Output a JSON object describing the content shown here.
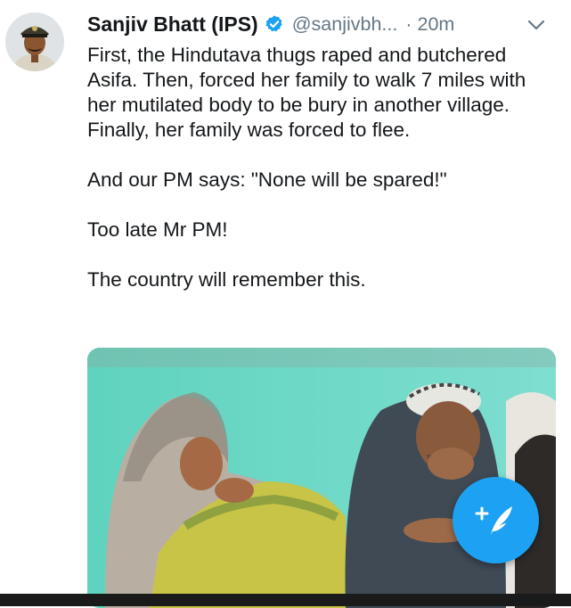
{
  "tweet": {
    "author_name": "Sanjiv Bhatt (IPS)",
    "handle": "@sanjivbh...",
    "separator": "·",
    "time": "20m",
    "verified": true,
    "paragraphs": [
      "First, the Hindutava thugs raped and butchered Asifa. Then, forced her family to walk 7 miles with her mutilated body to be bury in another village. Finally, her family was forced to flee.",
      "And our PM says: \"None will be spared!\"",
      "Too late Mr PM!",
      "The country will remember this."
    ]
  },
  "icons": {
    "verified": "verified-badge-icon",
    "menu": "chevron-down-icon",
    "compose": "compose-tweet-icon"
  },
  "colors": {
    "accent": "#1da1f2",
    "secondary_text": "#657786",
    "primary_text": "#14171a"
  }
}
